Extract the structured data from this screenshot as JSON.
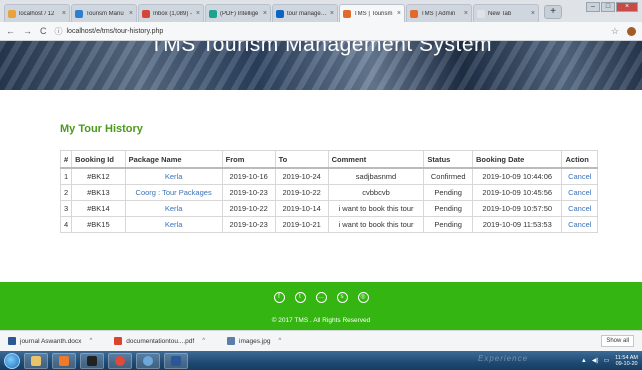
{
  "browser": {
    "tabs": [
      {
        "label": "localhost / 12",
        "color": "#e8a33c"
      },
      {
        "label": "Tourism Manu",
        "color": "#2f7fd1"
      },
      {
        "label": "Inbox (1,089) -",
        "color": "#d44638"
      },
      {
        "label": "(PDF) Intellige",
        "color": "#1aa38e"
      },
      {
        "label": "tour manageme",
        "color": "#0a66c2"
      },
      {
        "label": "TMS | Tourism",
        "color": "#e06b2c"
      },
      {
        "label": "TMS | Admin",
        "color": "#e06b2c"
      },
      {
        "label": "New Tab",
        "color": "#dfe3e8"
      }
    ],
    "url": "localhost/e/tms/tour-history.php"
  },
  "banner": {
    "title": "TMS Tourism Management System"
  },
  "page": {
    "title": "My Tour History"
  },
  "table": {
    "headers": [
      "#",
      "Booking Id",
      "Package Name",
      "From",
      "To",
      "Comment",
      "Status",
      "Booking Date",
      "Action"
    ],
    "rows": [
      {
        "num": "1",
        "id": "#BK12",
        "package": "Kerla",
        "from": "2019-10-16",
        "to": "2019-10-24",
        "comment": "sadjbasnmd",
        "status": "Confirmed",
        "date": "2019-10-09 10:44:06",
        "action": "Cancel"
      },
      {
        "num": "2",
        "id": "#BK13",
        "package": "Coorg : Tour Packages",
        "from": "2019-10-23",
        "to": "2019-10-22",
        "comment": "cvbbcvb",
        "status": "Pending",
        "date": "2019-10-09 10:45:56",
        "action": "Cancel"
      },
      {
        "num": "3",
        "id": "#BK14",
        "package": "Kerla",
        "from": "2019-10-22",
        "to": "2019-10-14",
        "comment": "i want to book this tour",
        "status": "Pending",
        "date": "2019-10-09 10:57:50",
        "action": "Cancel"
      },
      {
        "num": "4",
        "id": "#BK15",
        "package": "Kerla",
        "from": "2019-10-23",
        "to": "2019-10-21",
        "comment": "i want to book this tour",
        "status": "Pending",
        "date": "2019-10-09 11:53:53",
        "action": "Cancel"
      }
    ]
  },
  "footer": {
    "copyright": "© 2017 TMS . All Rights Reserved"
  },
  "downloads": {
    "items": [
      {
        "label": "journal Aswanth.docx",
        "color": "#2b5797"
      },
      {
        "label": "documentationtou....pdf",
        "color": "#d9452f"
      },
      {
        "label": "images.jpg",
        "color": "#5c7fa8"
      }
    ],
    "show_all": "Show all"
  },
  "taskbar": {
    "watermark": "Experience",
    "time": "11:54 AM",
    "date": "09-10-20"
  }
}
